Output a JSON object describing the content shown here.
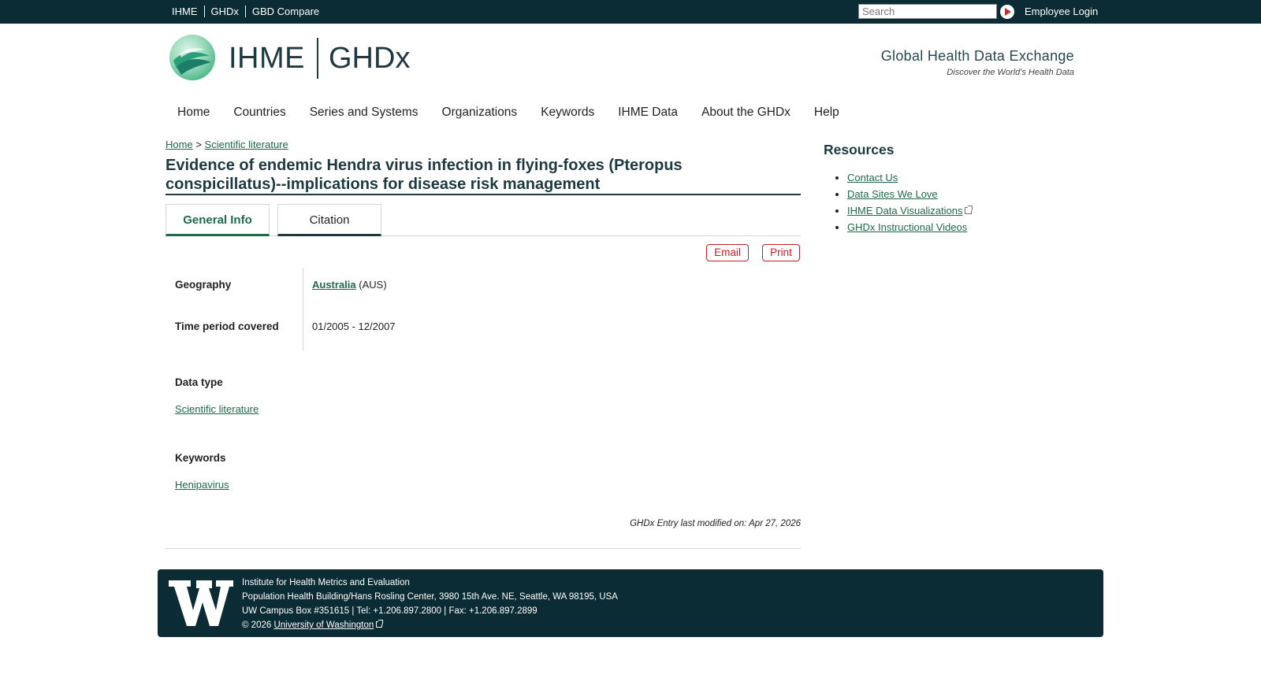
{
  "topbar": {
    "links": [
      "IHME",
      "GHDx",
      "GBD Compare"
    ],
    "search_placeholder": "Search",
    "employee_login": "Employee Login"
  },
  "header": {
    "logo_ihme": "IHME",
    "logo_ghdx": "GHDx",
    "tagline_title": "Global Health Data Exchange",
    "tagline_sub": "Discover the World's Health Data"
  },
  "nav": [
    "Home",
    "Countries",
    "Series and Systems",
    "Organizations",
    "Keywords",
    "IHME Data",
    "About the GHDx",
    "Help"
  ],
  "breadcrumb": {
    "home": "Home",
    "separator": ">",
    "section": "Scientific literature"
  },
  "page_title": "Evidence of endemic Hendra virus infection in flying-foxes (Pteropus conspicillatus)--implications for disease risk management",
  "tabs": {
    "general": "General Info",
    "citation": "Citation"
  },
  "actions": {
    "email": "Email",
    "print": "Print"
  },
  "info": {
    "geography_label": "Geography",
    "geography_link": "Australia",
    "geography_code": "(AUS)",
    "time_label": "Time period covered",
    "time_value": "01/2005 - 12/2007",
    "datatype_label": "Data type",
    "datatype_value": "Scientific literature",
    "keywords_label": "Keywords",
    "keywords_value": "Henipavirus"
  },
  "modified": "GHDx Entry last modified on: Apr 27, 2026",
  "sidebar": {
    "title": "Resources",
    "items": [
      "Contact Us",
      "Data Sites We Love",
      "IHME Data Visualizations",
      "GHDx Instructional Videos"
    ]
  },
  "footer": {
    "line1": "Institute for Health Metrics and Evaluation",
    "line2": "Population Health Building/Hans Rosling Center, 3980 15th Ave. NE, Seattle, WA 98195, USA",
    "line3": "UW Campus Box #351615 | Tel: +1.206.897.2800 | Fax: +1.206.897.2899",
    "copyright": "© 2026",
    "uw_link": "University of Washington"
  },
  "colors": {
    "topbar_bg": "#0b2c34",
    "link_green": "#1e6a4a",
    "action_red": "#c8202b",
    "heading_dark": "#1e3a3f"
  }
}
